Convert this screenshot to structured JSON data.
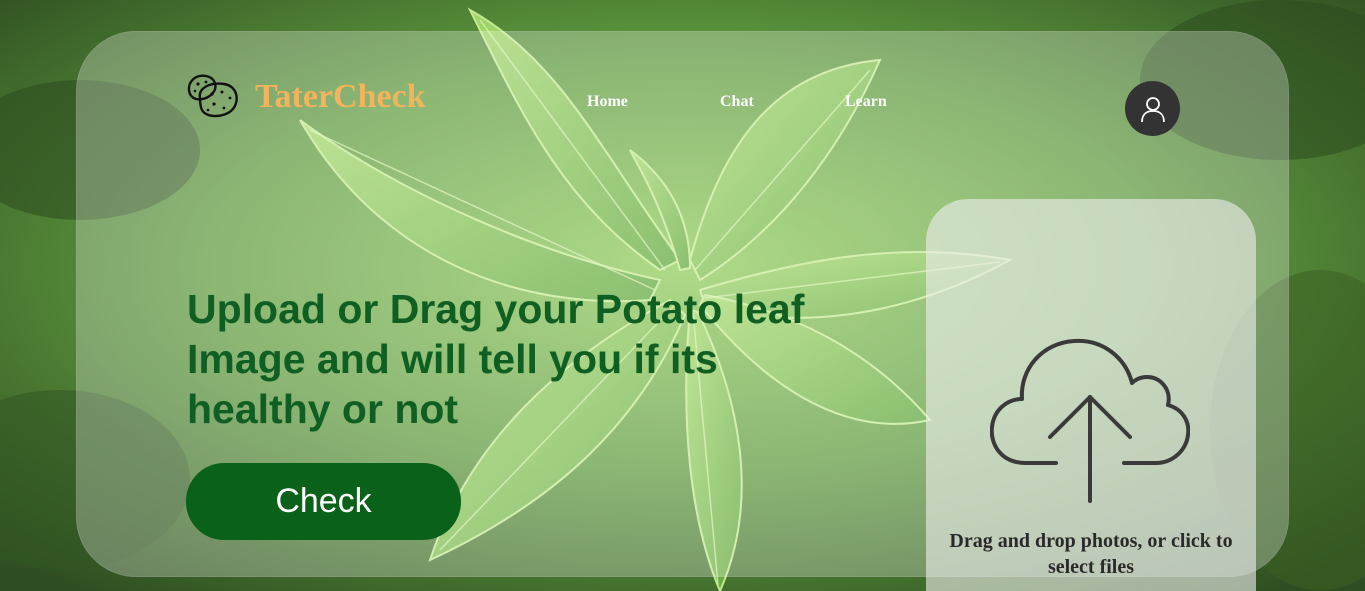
{
  "brand": {
    "name": "TaterCheck",
    "logo_icon": "potato-logo-icon",
    "name_color": "#f2b45c"
  },
  "nav": {
    "items": [
      {
        "label": "Home"
      },
      {
        "label": "Chat"
      },
      {
        "label": "Learn"
      }
    ]
  },
  "user": {
    "avatar_icon": "user-icon"
  },
  "hero": {
    "headline": "Upload or Drag your Potato leaf Image and will tell you if its healthy or not",
    "headline_color": "#0f5f22",
    "check_label": "Check",
    "check_color": "#0a6119"
  },
  "upload": {
    "icon": "cloud-upload-icon",
    "hint": "Drag and drop photos, or click to select files"
  }
}
